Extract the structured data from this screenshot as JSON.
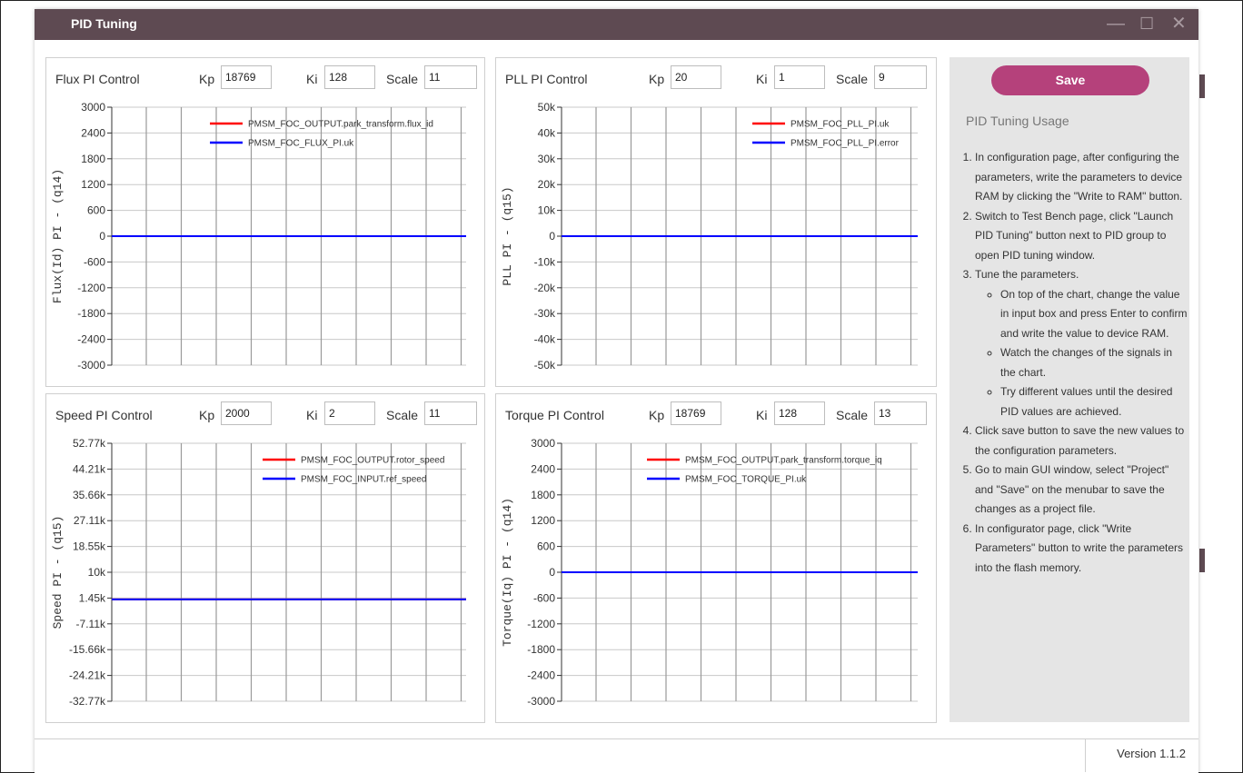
{
  "window": {
    "title": "PID Tuning",
    "version": "Version 1.1.2"
  },
  "colors": {
    "titlebar": "#5e4a52",
    "accent": "#b5417b",
    "series_red": "#ff0000",
    "series_blue": "#0000ff"
  },
  "panels": {
    "flux": {
      "title": "Flux PI Control",
      "kp_label": "Kp",
      "kp": "18769",
      "ki_label": "Ki",
      "ki": "128",
      "scale_label": "Scale",
      "scale": "11"
    },
    "pll": {
      "title": "PLL PI Control",
      "kp_label": "Kp",
      "kp": "20",
      "ki_label": "Ki",
      "ki": "1",
      "scale_label": "Scale",
      "scale": "9"
    },
    "speed": {
      "title": "Speed PI Control",
      "kp_label": "Kp",
      "kp": "2000",
      "ki_label": "Ki",
      "ki": "2",
      "scale_label": "Scale",
      "scale": "11"
    },
    "torque": {
      "title": "Torque PI Control",
      "kp_label": "Kp",
      "kp": "18769",
      "ki_label": "Ki",
      "ki": "128",
      "scale_label": "Scale",
      "scale": "13"
    }
  },
  "side": {
    "save_label": "Save",
    "usage_title": "PID Tuning Usage",
    "steps": [
      "In configuration page, after configuring the parameters, write the parameters to device RAM by clicking the \"Write to RAM\" button.",
      "Switch to Test Bench page, click \"Launch PID Tuning\" button next to PID group to open PID tuning window.",
      "Tune the parameters.",
      "Click save button to save the new values to the configuration parameters.",
      "Go to main GUI window, select \"Project\" and \"Save\" on the menubar to save the changes as a project file.",
      "In configurator page, click \"Write Parameters\" button to write the parameters into the flash memory."
    ],
    "substeps": [
      "On top of the chart, change the value in input box and press Enter to confirm and write the value to device RAM.",
      "Watch the changes of the signals in the chart.",
      "Try different values until the desired PID values are achieved."
    ]
  },
  "chart_data": [
    {
      "type": "line",
      "ylabel": "Flux(Id) PI - (q14)",
      "yticks": [
        "3000",
        "2400",
        "1800",
        "1200",
        "600",
        "0",
        "-600",
        "-1200",
        "-1800",
        "-2400",
        "-3000"
      ],
      "ylim": [
        -3000,
        3000
      ],
      "grid": true,
      "legend_position": "top-right",
      "series": [
        {
          "name": "PMSM_FOC_OUTPUT.park_transform.flux_id",
          "color": "#ff0000",
          "values": [
            0,
            0
          ]
        },
        {
          "name": "PMSM_FOC_FLUX_PI.uk",
          "color": "#0000ff",
          "values": [
            0,
            0
          ]
        }
      ]
    },
    {
      "type": "line",
      "ylabel": "PLL PI - (q15)",
      "yticks": [
        "50k",
        "40k",
        "30k",
        "20k",
        "10k",
        "0",
        "-10k",
        "-20k",
        "-30k",
        "-40k",
        "-50k"
      ],
      "ylim": [
        -50000,
        50000
      ],
      "grid": true,
      "legend_position": "top-right",
      "series": [
        {
          "name": "PMSM_FOC_PLL_PI.uk",
          "color": "#ff0000",
          "values": [
            0,
            0
          ]
        },
        {
          "name": "PMSM_FOC_PLL_PI.error",
          "color": "#0000ff",
          "values": [
            0,
            0
          ]
        }
      ]
    },
    {
      "type": "line",
      "ylabel": "Speed PI - (q15)",
      "yticks": [
        "52.77k",
        "44.21k",
        "35.66k",
        "27.11k",
        "18.55k",
        "10k",
        "1.45k",
        "-7.11k",
        "-15.66k",
        "-24.21k",
        "-32.77k"
      ],
      "ylim": [
        -32770,
        52770
      ],
      "grid": true,
      "legend_position": "top-right",
      "series": [
        {
          "name": "PMSM_FOC_OUTPUT.rotor_speed",
          "color": "#ff0000",
          "values": [
            1000,
            1000
          ]
        },
        {
          "name": "PMSM_FOC_INPUT.ref_speed",
          "color": "#0000ff",
          "values": [
            1000,
            1000
          ]
        }
      ]
    },
    {
      "type": "line",
      "ylabel": "Torque(Iq) PI - (q14)",
      "yticks": [
        "3000",
        "2400",
        "1800",
        "1200",
        "600",
        "0",
        "-600",
        "-1200",
        "-1800",
        "-2400",
        "-3000"
      ],
      "ylim": [
        -3000,
        3000
      ],
      "grid": true,
      "legend_position": "top-right",
      "series": [
        {
          "name": "PMSM_FOC_OUTPUT.park_transform.torque_iq",
          "color": "#ff0000",
          "values": [
            0,
            0
          ]
        },
        {
          "name": "PMSM_FOC_TORQUE_PI.uk",
          "color": "#0000ff",
          "values": [
            0,
            0
          ]
        }
      ]
    }
  ]
}
